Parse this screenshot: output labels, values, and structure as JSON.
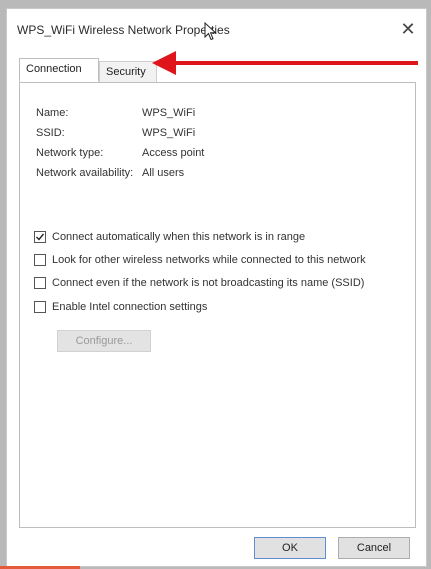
{
  "window": {
    "title": "WPS_WiFi Wireless Network Properties",
    "close_label": "✕"
  },
  "tabs": [
    {
      "label": "Connection",
      "selected": true
    },
    {
      "label": "Security",
      "selected": false
    }
  ],
  "info": [
    {
      "label": "Name:",
      "value": "WPS_WiFi"
    },
    {
      "label": "SSID:",
      "value": "WPS_WiFi"
    },
    {
      "label": "Network type:",
      "value": "Access point"
    },
    {
      "label": "Network availability:",
      "value": "All users"
    }
  ],
  "options": [
    {
      "label": "Connect automatically when this network is in range",
      "checked": true
    },
    {
      "label": "Look for other wireless networks while connected to this network",
      "checked": false
    },
    {
      "label": "Connect even if the network is not broadcasting its name (SSID)",
      "checked": false
    },
    {
      "label": "Enable Intel connection settings",
      "checked": false
    }
  ],
  "configure_label": "Configure...",
  "buttons": {
    "ok_label": "OK",
    "cancel_label": "Cancel"
  },
  "colors": {
    "annotation_arrow": "#e0141b"
  }
}
